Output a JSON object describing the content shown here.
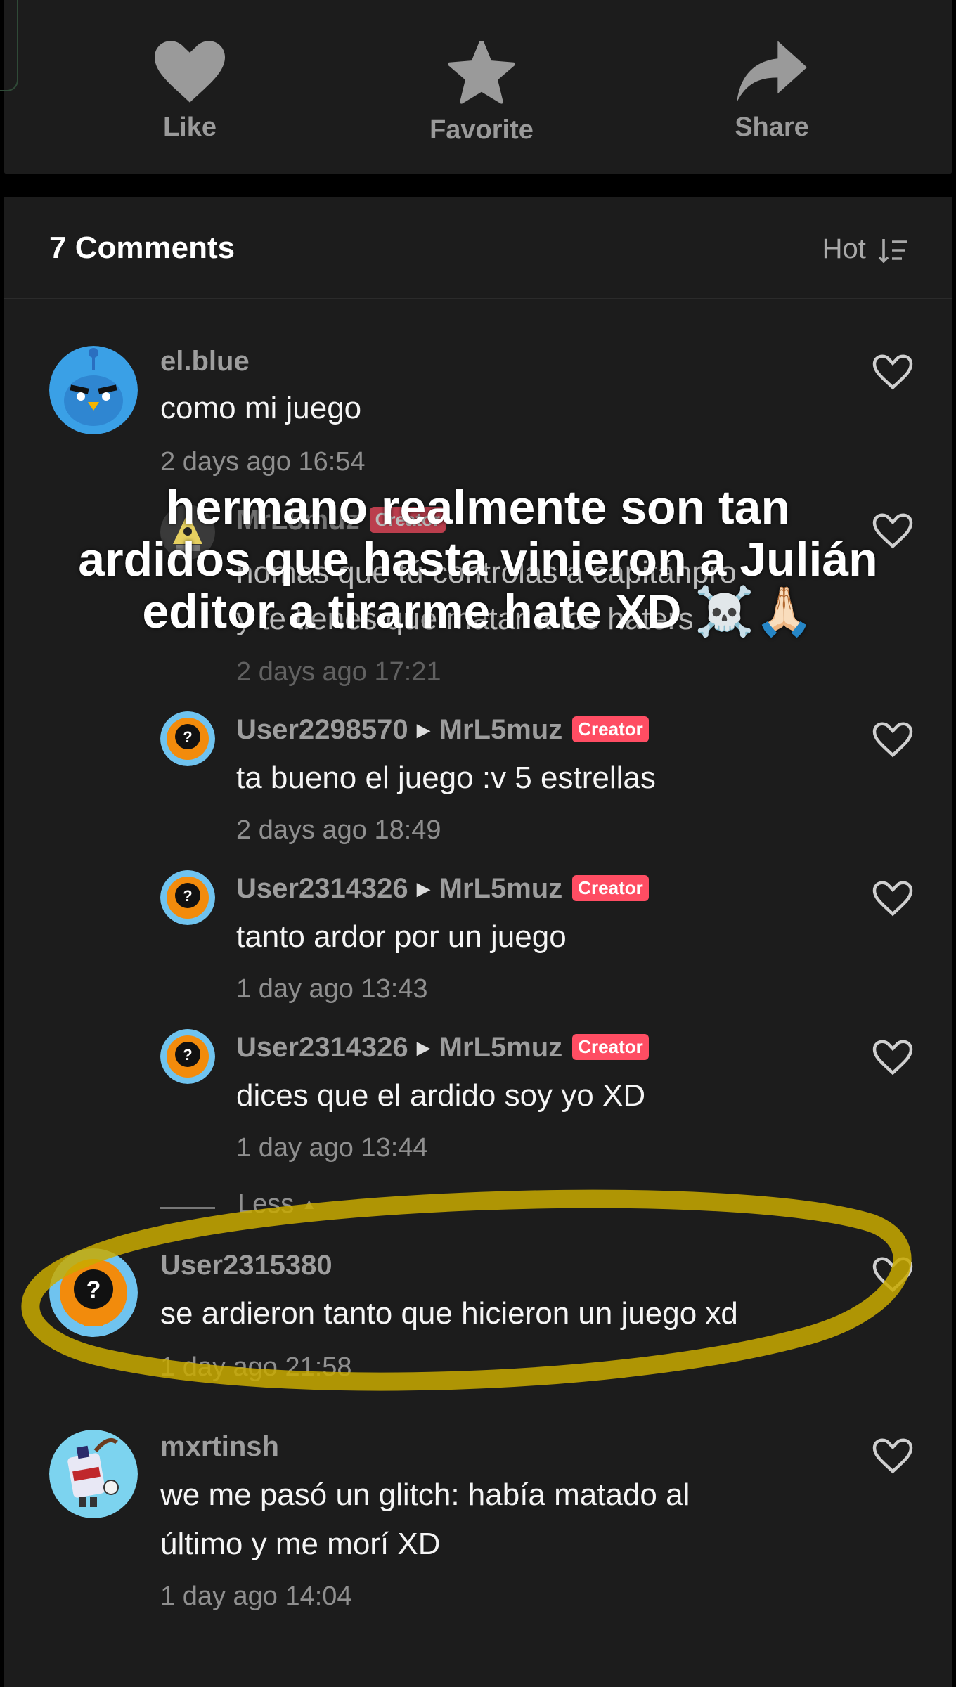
{
  "actions": [
    {
      "label": "Like",
      "icon": "heart-icon"
    },
    {
      "label": "Favorite",
      "icon": "star-icon"
    },
    {
      "label": "Share",
      "icon": "share-icon"
    }
  ],
  "comments_header": {
    "title": "7 Comments",
    "sort_label": "Hot"
  },
  "comments": [
    {
      "user": "el.blue",
      "text": "como mi juego",
      "time": "2 days ago 16:54"
    },
    {
      "user": "MrL5muz",
      "badge": "Creator",
      "text_line1": "nomas que tú controlas a capitánpro",
      "text_line2": "y te tienes que matar a los haters",
      "time": "2 days ago 17:21"
    },
    {
      "user": "User2298570",
      "reply_to": "MrL5muz",
      "badge": "Creator",
      "text": "ta bueno el juego :v 5 estrellas",
      "time": "2 days ago 18:49"
    },
    {
      "user": "User2314326",
      "reply_to": "MrL5muz",
      "badge": "Creator",
      "text": "tanto ardor por un juego",
      "time": "1 day ago 13:43"
    },
    {
      "user": "User2314326",
      "reply_to": "MrL5muz",
      "badge": "Creator",
      "text": "dices que el ardido soy yo XD",
      "time": "1 day ago 13:44"
    },
    {
      "user": "User2315380",
      "text": "se ardieron tanto que hicieron un juego xd",
      "time": "1 day ago 21:58"
    },
    {
      "user": "mxrtinsh",
      "text_line1": "we me pasó un glitch: había matado al",
      "text_line2": "último y me morí XD",
      "time": "1 day ago 14:04"
    }
  ],
  "less_label": "Less",
  "overlay_caption": {
    "line1": "hermano realmente son tan",
    "line2": "ardidos que hasta vinieron a Julián",
    "line3": "editor a tirarme hate XD ☠️🙏🏻"
  },
  "colors": {
    "panel": "#1c1c1c",
    "creator_badge": "#ff4d63",
    "highlight": "#d4b400"
  }
}
